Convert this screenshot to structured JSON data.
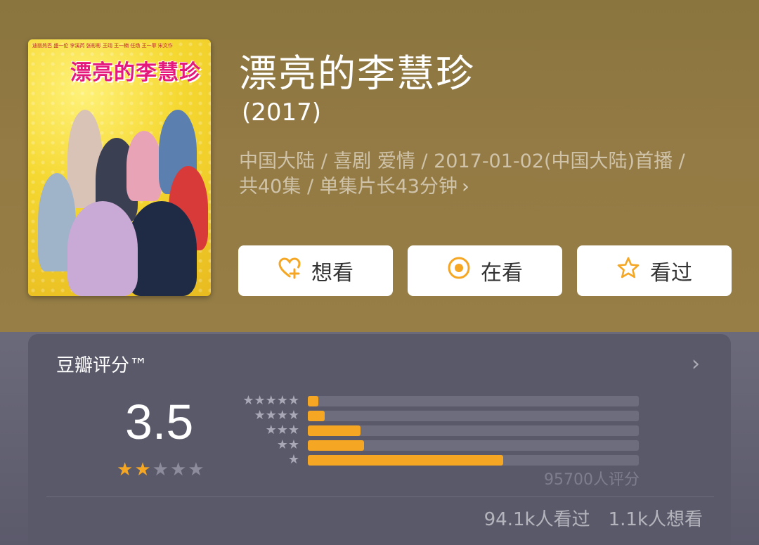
{
  "header": {
    "title": "漂亮的李慧珍",
    "year": "(2017)",
    "meta_line1": "中国大陆 / 喜剧 爱情 / 2017-01-02(中国大陆)首播 /",
    "meta_line2": "共40集 / 单集片长43分钟",
    "meta_chevron": "›",
    "bg_color": "#947a44"
  },
  "poster": {
    "title": "漂亮的李慧珍",
    "cast_text": "迪丽热巴  盛一伦 李溪芮 张彬彬 王翊 王一楠 任炀 王一菲 宋文作"
  },
  "actions": {
    "want": {
      "label": "想看",
      "icon": "heart-plus-icon"
    },
    "watching": {
      "label": "在看",
      "icon": "target-circle-icon"
    },
    "watched": {
      "label": "看过",
      "icon": "star-outline-icon"
    },
    "icon_color": "#f5a623"
  },
  "rating": {
    "title": "豆瓣评分™",
    "chevron": "›",
    "score": "3.5",
    "score_stars": 2,
    "stars_total": 5,
    "distribution": [
      {
        "stars": 5,
        "percent": 3
      },
      {
        "stars": 4,
        "percent": 5
      },
      {
        "stars": 3,
        "percent": 16
      },
      {
        "stars": 2,
        "percent": 17
      },
      {
        "stars": 1,
        "percent": 59
      }
    ],
    "count_text": "95700人评分",
    "bar_color": "#f5a623",
    "track_color": "#6e6d7e"
  },
  "stats": {
    "watched": "94.1k人看过",
    "wanted": "1.1k人想看"
  }
}
